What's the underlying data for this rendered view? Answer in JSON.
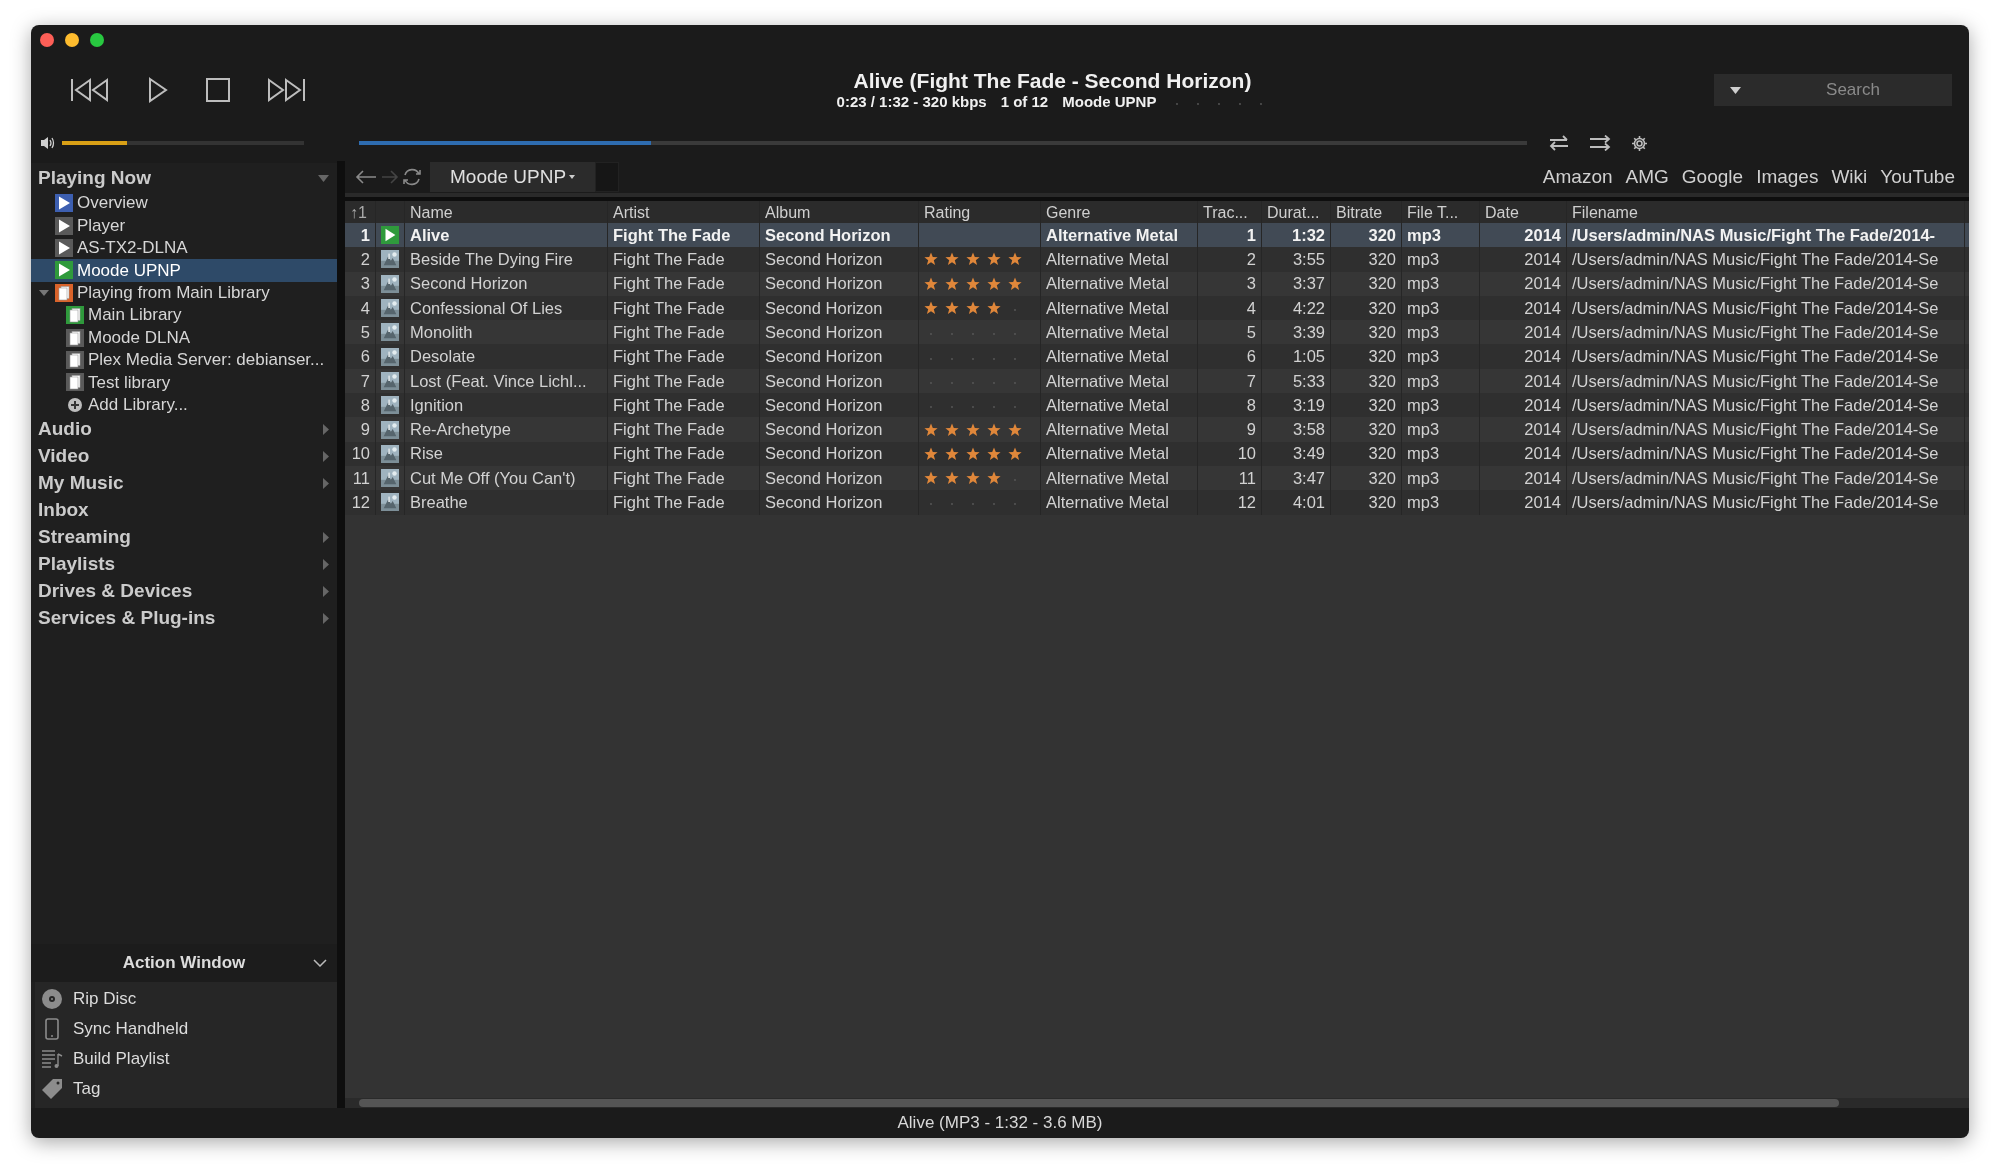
{
  "player": {
    "title": "Alive (Fight The Fade - Second Horizon)",
    "status": [
      "0:23 / 1:32 - 320 kbps",
      "1 of 12",
      "Moode UPNP"
    ],
    "stars": 0,
    "volume": {
      "level": 0.27
    },
    "progress": {
      "level": 0.25
    }
  },
  "search": {
    "placeholder": "Search"
  },
  "sidebar": {
    "sections": [
      {
        "label": "Playing Now",
        "expanded": true,
        "children": [
          {
            "label": "Overview",
            "kind": "player",
            "color": "#3d5fb0",
            "selected": false
          },
          {
            "label": "Player",
            "kind": "player",
            "color": "#5a5a5a",
            "selected": false
          },
          {
            "label": "AS-TX2-DLNA",
            "kind": "player",
            "color": "#5a5a5a",
            "selected": false
          },
          {
            "label": "Moode UPNP",
            "kind": "player",
            "color": "#2f9a3c",
            "selected": true
          },
          {
            "label": "Playing from Main Library",
            "kind": "library",
            "color": "#d9632a",
            "selected": false,
            "expanded": true,
            "children": [
              {
                "label": "Main Library",
                "kind": "library",
                "color": "#2f9a3c",
                "selected": false
              },
              {
                "label": "Moode DLNA",
                "kind": "library",
                "color": "#5a5a5a",
                "selected": false
              },
              {
                "label": "Plex Media Server: debianser...",
                "kind": "library",
                "color": "#5a5a5a",
                "selected": false
              },
              {
                "label": "Test library",
                "kind": "library",
                "color": "#5a5a5a",
                "selected": false
              },
              {
                "label": "Add Library...",
                "kind": "add",
                "selected": false
              }
            ]
          }
        ]
      },
      {
        "label": "Audio",
        "has_submenu": true
      },
      {
        "label": "Video",
        "has_submenu": true
      },
      {
        "label": "My Music",
        "has_submenu": true
      },
      {
        "label": "Inbox",
        "has_submenu": false
      },
      {
        "label": "Streaming",
        "has_submenu": true
      },
      {
        "label": "Playlists",
        "has_submenu": true
      },
      {
        "label": "Drives & Devices",
        "has_submenu": true
      },
      {
        "label": "Services & Plug-ins",
        "has_submenu": true
      }
    ]
  },
  "action_window": {
    "title": "Action Window",
    "expanded": true,
    "items": [
      {
        "label": "Rip Disc",
        "kind": "disc"
      },
      {
        "label": "Sync Handheld",
        "kind": "phone"
      },
      {
        "label": "Build Playlist",
        "kind": "playlist"
      },
      {
        "label": "Tag",
        "kind": "tag"
      }
    ]
  },
  "toolbar": {
    "tab": "Moode UPNP",
    "links": [
      "Amazon",
      "AMG",
      "Google",
      "Images",
      "Wiki",
      "YouTube"
    ]
  },
  "table": {
    "columns": [
      "↑1",
      "Name",
      "Artist",
      "Album",
      "Rating",
      "Genre",
      "Trac...",
      "Durat...",
      "Bitrate",
      "File T...",
      "Date",
      "Filename"
    ],
    "rows": [
      {
        "number": "1",
        "playing": true,
        "selected": true,
        "name": "Alive",
        "artist": "Fight The Fade",
        "album": "Second Horizon",
        "genre": "Alternative Metal",
        "track": "1",
        "duration": "1:32",
        "bitrate": "320",
        "file_type": "mp3",
        "date": "2014",
        "filename": "/Users/admin/NAS Music/Fight The Fade/2014-"
      },
      {
        "number": "2",
        "playing": false,
        "selected": false,
        "name": "Beside The Dying Fire",
        "artist": "Fight The Fade",
        "album": "Second Horizon",
        "stars": 5,
        "genre": "Alternative Metal",
        "track": "2",
        "duration": "3:55",
        "bitrate": "320",
        "file_type": "mp3",
        "date": "2014",
        "filename": "/Users/admin/NAS Music/Fight The Fade/2014-Se"
      },
      {
        "number": "3",
        "playing": false,
        "selected": false,
        "name": "Second Horizon",
        "artist": "Fight The Fade",
        "album": "Second Horizon",
        "stars": 5,
        "genre": "Alternative Metal",
        "track": "3",
        "duration": "3:37",
        "bitrate": "320",
        "file_type": "mp3",
        "date": "2014",
        "filename": "/Users/admin/NAS Music/Fight The Fade/2014-Se"
      },
      {
        "number": "4",
        "playing": false,
        "selected": false,
        "name": "Confessional Of Lies",
        "artist": "Fight The Fade",
        "album": "Second Horizon",
        "stars": 4,
        "genre": "Alternative Metal",
        "track": "4",
        "duration": "4:22",
        "bitrate": "320",
        "file_type": "mp3",
        "date": "2014",
        "filename": "/Users/admin/NAS Music/Fight The Fade/2014-Se"
      },
      {
        "number": "5",
        "playing": false,
        "selected": false,
        "name": "Monolith",
        "artist": "Fight The Fade",
        "album": "Second Horizon",
        "stars": 0,
        "genre": "Alternative Metal",
        "track": "5",
        "duration": "3:39",
        "bitrate": "320",
        "file_type": "mp3",
        "date": "2014",
        "filename": "/Users/admin/NAS Music/Fight The Fade/2014-Se"
      },
      {
        "number": "6",
        "playing": false,
        "selected": false,
        "name": "Desolate",
        "artist": "Fight The Fade",
        "album": "Second Horizon",
        "stars": 0,
        "genre": "Alternative Metal",
        "track": "6",
        "duration": "1:05",
        "bitrate": "320",
        "file_type": "mp3",
        "date": "2014",
        "filename": "/Users/admin/NAS Music/Fight The Fade/2014-Se"
      },
      {
        "number": "7",
        "playing": false,
        "selected": false,
        "name": "Lost (Feat. Vince Lichl...",
        "artist": "Fight The Fade",
        "album": "Second Horizon",
        "stars": 0,
        "genre": "Alternative Metal",
        "track": "7",
        "duration": "5:33",
        "bitrate": "320",
        "file_type": "mp3",
        "date": "2014",
        "filename": "/Users/admin/NAS Music/Fight The Fade/2014-Se"
      },
      {
        "number": "8",
        "playing": false,
        "selected": false,
        "name": "Ignition",
        "artist": "Fight The Fade",
        "album": "Second Horizon",
        "stars": 0,
        "genre": "Alternative Metal",
        "track": "8",
        "duration": "3:19",
        "bitrate": "320",
        "file_type": "mp3",
        "date": "2014",
        "filename": "/Users/admin/NAS Music/Fight The Fade/2014-Se"
      },
      {
        "number": "9",
        "playing": false,
        "selected": false,
        "name": "Re-Archetype",
        "artist": "Fight The Fade",
        "album": "Second Horizon",
        "stars": 5,
        "genre": "Alternative Metal",
        "track": "9",
        "duration": "3:58",
        "bitrate": "320",
        "file_type": "mp3",
        "date": "2014",
        "filename": "/Users/admin/NAS Music/Fight The Fade/2014-Se"
      },
      {
        "number": "10",
        "playing": false,
        "selected": false,
        "name": "Rise",
        "artist": "Fight The Fade",
        "album": "Second Horizon",
        "stars": 5,
        "genre": "Alternative Metal",
        "track": "10",
        "duration": "3:49",
        "bitrate": "320",
        "file_type": "mp3",
        "date": "2014",
        "filename": "/Users/admin/NAS Music/Fight The Fade/2014-Se"
      },
      {
        "number": "11",
        "playing": false,
        "selected": false,
        "name": "Cut Me Off (You Can't)",
        "artist": "Fight The Fade",
        "album": "Second Horizon",
        "stars": 4,
        "genre": "Alternative Metal",
        "track": "11",
        "duration": "3:47",
        "bitrate": "320",
        "file_type": "mp3",
        "date": "2014",
        "filename": "/Users/admin/NAS Music/Fight The Fade/2014-Se"
      },
      {
        "number": "12",
        "playing": false,
        "selected": false,
        "name": "Breathe",
        "artist": "Fight The Fade",
        "album": "Second Horizon",
        "stars": 0,
        "genre": "Alternative Metal",
        "track": "12",
        "duration": "4:01",
        "bitrate": "320",
        "file_type": "mp3",
        "date": "2014",
        "filename": "/Users/admin/NAS Music/Fight The Fade/2014-Se"
      }
    ]
  },
  "status_bar": "Alive (MP3 - 1:32 - 3.6 MB)"
}
